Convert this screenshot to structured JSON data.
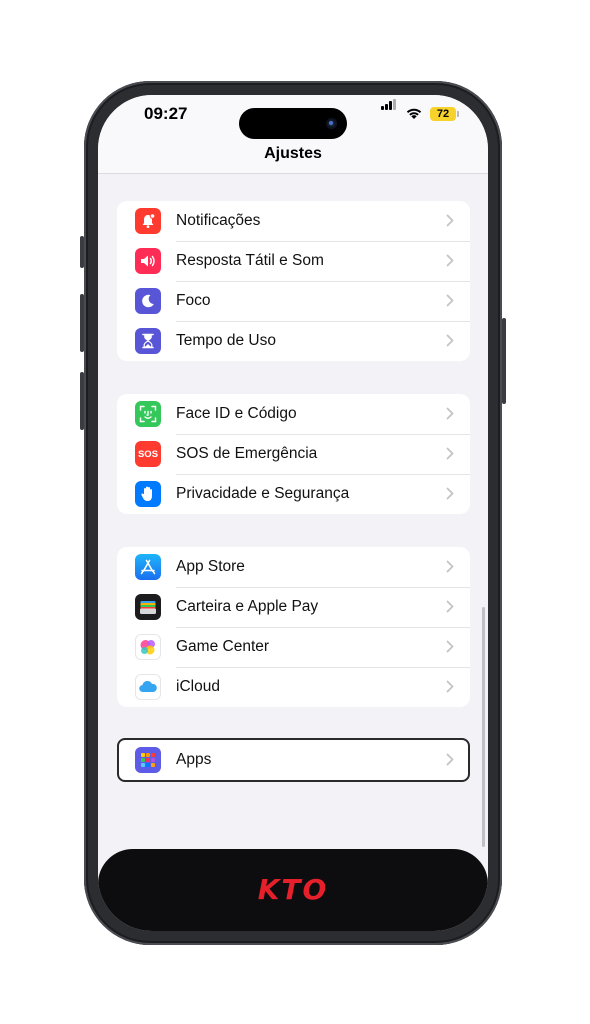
{
  "status_bar": {
    "time": "09:27",
    "battery": "72"
  },
  "header": {
    "title": "Ajustes"
  },
  "groups": [
    {
      "items": [
        {
          "label": "Notificações",
          "icon": "bell-badge-icon",
          "color": "#ff3b30"
        },
        {
          "label": "Resposta Tátil e Som",
          "icon": "speaker-icon",
          "color": "#ff2d55"
        },
        {
          "label": "Foco",
          "icon": "moon-icon",
          "color": "#5856d6"
        },
        {
          "label": "Tempo de Uso",
          "icon": "hourglass-icon",
          "color": "#5856d6"
        }
      ]
    },
    {
      "items": [
        {
          "label": "Face ID e Código",
          "icon": "face-id-icon",
          "color": "#34c759"
        },
        {
          "label": "SOS de Emergência",
          "icon": "sos-icon",
          "color": "#ff3b30",
          "icon_text": "SOS"
        },
        {
          "label": "Privacidade e Segurança",
          "icon": "hand-icon",
          "color": "#007aff"
        }
      ]
    },
    {
      "items": [
        {
          "label": "App Store",
          "icon": "app-store-icon",
          "color": "#1a8cff"
        },
        {
          "label": "Carteira e Apple Pay",
          "icon": "wallet-icon",
          "color": "#1c1c1e"
        },
        {
          "label": "Game Center",
          "icon": "game-center-icon",
          "color": "#ffffff"
        },
        {
          "label": "iCloud",
          "icon": "icloud-icon",
          "color": "#ffffff"
        }
      ]
    },
    {
      "items": [
        {
          "label": "Apps",
          "icon": "apps-grid-icon",
          "color": "#5e5ce6"
        }
      ]
    }
  ],
  "banner": {
    "brand": "KTO",
    "brand_color": "#e5202b"
  }
}
